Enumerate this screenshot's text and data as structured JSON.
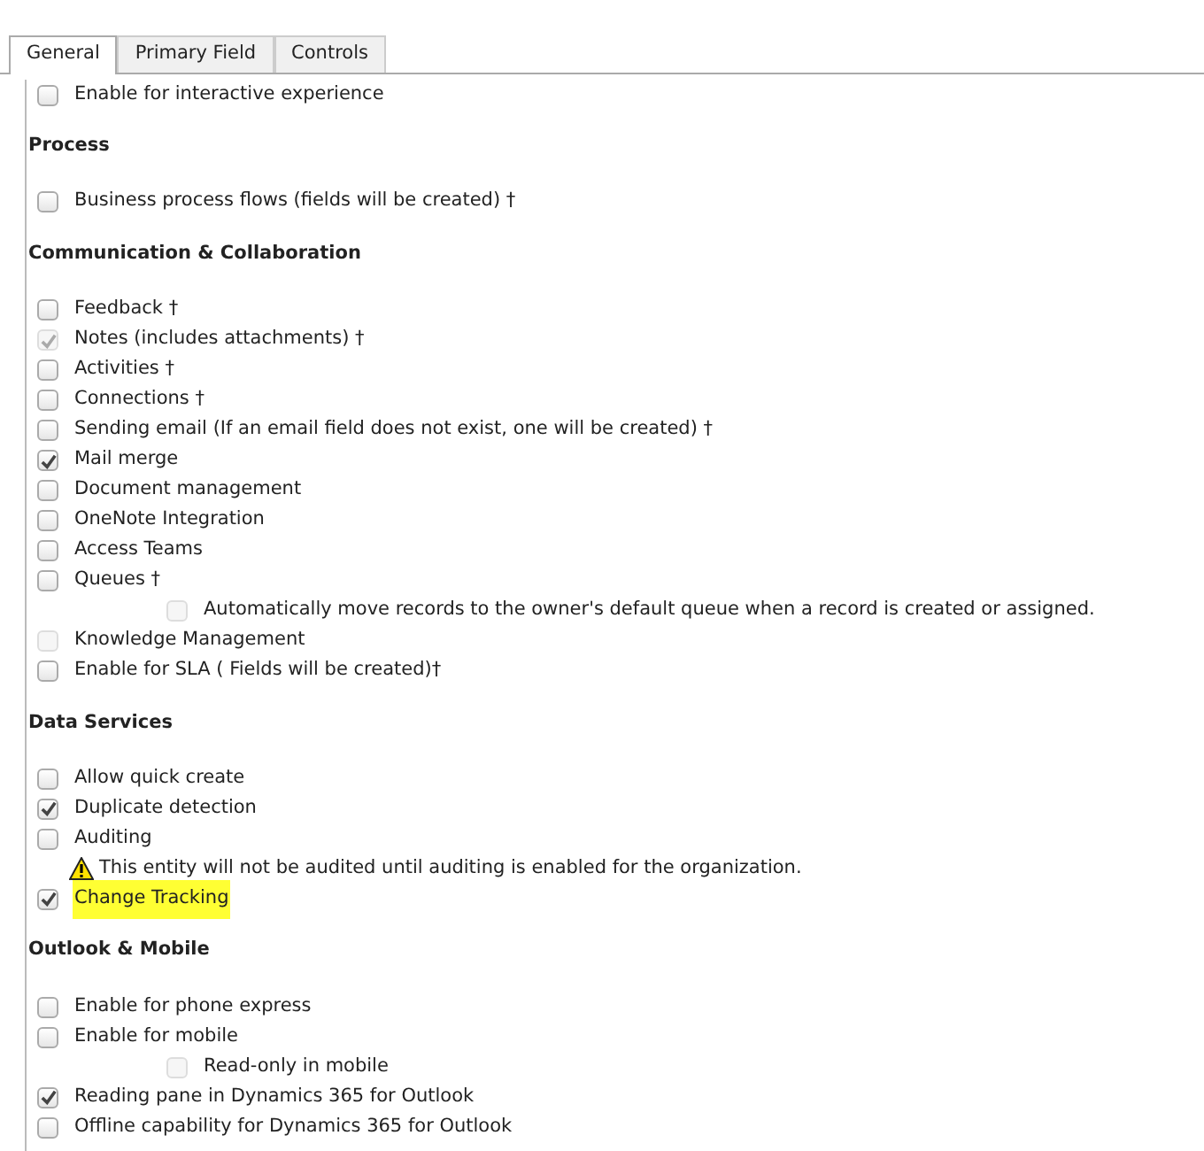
{
  "tabs": [
    {
      "label": "General",
      "selected": true
    },
    {
      "label": "Primary Field",
      "selected": false
    },
    {
      "label": "Controls",
      "selected": false
    }
  ],
  "sections": [
    {
      "items": [
        {
          "kind": "checkbox",
          "label": "Enable for interactive experience",
          "checked": false,
          "disabled": false
        }
      ]
    },
    {
      "heading": "Process",
      "items": [
        {
          "kind": "checkbox",
          "label": "Business process flows (fields will be created) †",
          "checked": false,
          "disabled": false
        }
      ]
    },
    {
      "heading": "Communication & Collaboration",
      "items": [
        {
          "kind": "checkbox",
          "label": "Feedback †",
          "checked": false,
          "disabled": false
        },
        {
          "kind": "checkbox",
          "label": "Notes (includes attachments) †",
          "checked": true,
          "disabled": true
        },
        {
          "kind": "checkbox",
          "label": "Activities †",
          "checked": false,
          "disabled": false
        },
        {
          "kind": "checkbox",
          "label": "Connections †",
          "checked": false,
          "disabled": false
        },
        {
          "kind": "checkbox",
          "label": "Sending email (If an email field does not exist, one will be created) †",
          "checked": false,
          "disabled": false
        },
        {
          "kind": "checkbox",
          "label": "Mail merge",
          "checked": true,
          "disabled": false
        },
        {
          "kind": "checkbox",
          "label": "Document management",
          "checked": false,
          "disabled": false
        },
        {
          "kind": "checkbox",
          "label": "OneNote Integration",
          "checked": false,
          "disabled": false
        },
        {
          "kind": "checkbox",
          "label": "Access Teams",
          "checked": false,
          "disabled": false
        },
        {
          "kind": "checkbox",
          "label": "Queues †",
          "checked": false,
          "disabled": false,
          "children": [
            {
              "kind": "checkbox",
              "label": "Automatically move records to the owner's default queue when a record is created or assigned.",
              "checked": false,
              "disabled": true
            }
          ]
        },
        {
          "kind": "checkbox",
          "label": "Knowledge Management",
          "checked": false,
          "disabled": true
        },
        {
          "kind": "checkbox",
          "label": "Enable for SLA ( Fields will be created)†",
          "checked": false,
          "disabled": false
        }
      ]
    },
    {
      "heading": "Data Services",
      "items": [
        {
          "kind": "checkbox",
          "label": "Allow quick create",
          "checked": false,
          "disabled": false
        },
        {
          "kind": "checkbox",
          "label": "Duplicate detection",
          "checked": true,
          "disabled": false
        },
        {
          "kind": "checkbox",
          "label": "Auditing",
          "checked": false,
          "disabled": false,
          "children": [
            {
              "kind": "warning",
              "label": "This entity will not be audited until auditing is enabled for the organization."
            }
          ]
        },
        {
          "kind": "checkbox",
          "label": "Change Tracking",
          "checked": true,
          "disabled": false,
          "highlighted": true
        }
      ]
    },
    {
      "heading": "Outlook & Mobile",
      "items": [
        {
          "kind": "checkbox",
          "label": "Enable for phone express",
          "checked": false,
          "disabled": false
        },
        {
          "kind": "checkbox",
          "label": "Enable for mobile",
          "checked": false,
          "disabled": false,
          "children": [
            {
              "kind": "checkbox",
              "label": "Read-only in mobile",
              "checked": false,
              "disabled": true
            }
          ]
        },
        {
          "kind": "checkbox",
          "label": "Reading pane in Dynamics 365 for Outlook",
          "checked": true,
          "disabled": false
        },
        {
          "kind": "checkbox",
          "label": "Offline capability for Dynamics 365 for Outlook",
          "checked": false,
          "disabled": false
        }
      ]
    }
  ]
}
